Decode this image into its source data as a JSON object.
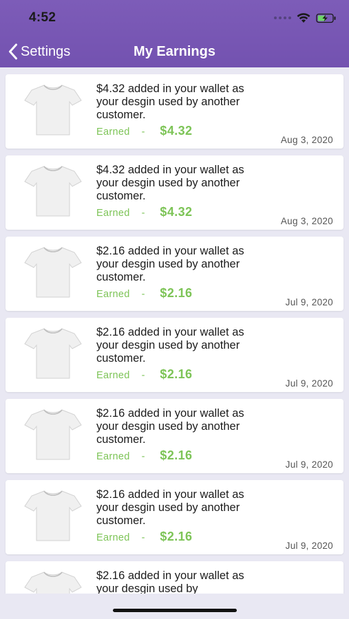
{
  "status_bar": {
    "time": "4:52"
  },
  "nav": {
    "back_label": "Settings",
    "title": "My Earnings"
  },
  "colors": {
    "header": "#7352b0",
    "earned": "#7dc457"
  },
  "earnings": [
    {
      "message": "$4.32 added in your wallet as your desgin used by another customer.",
      "earned_label": "Earned",
      "separator": "-",
      "amount": "$4.32",
      "date": "Aug 3, 2020"
    },
    {
      "message": "$4.32 added in your wallet as your desgin used by another customer.",
      "earned_label": "Earned",
      "separator": "-",
      "amount": "$4.32",
      "date": "Aug 3, 2020"
    },
    {
      "message": "$2.16 added in your wallet as your desgin used by another customer.",
      "earned_label": "Earned",
      "separator": "-",
      "amount": "$2.16",
      "date": "Jul 9, 2020"
    },
    {
      "message": "$2.16 added in your wallet as your desgin used by another customer.",
      "earned_label": "Earned",
      "separator": "-",
      "amount": "$2.16",
      "date": "Jul 9, 2020"
    },
    {
      "message": "$2.16 added in your wallet as your desgin used by another customer.",
      "earned_label": "Earned",
      "separator": "-",
      "amount": "$2.16",
      "date": "Jul 9, 2020"
    },
    {
      "message": "$2.16 added in your wallet as your desgin used by another customer.",
      "earned_label": "Earned",
      "separator": "-",
      "amount": "$2.16",
      "date": "Jul 9, 2020"
    },
    {
      "message": "$2.16 added in your wallet as your desgin used by",
      "earned_label": "",
      "separator": "",
      "amount": "",
      "date": ""
    }
  ]
}
